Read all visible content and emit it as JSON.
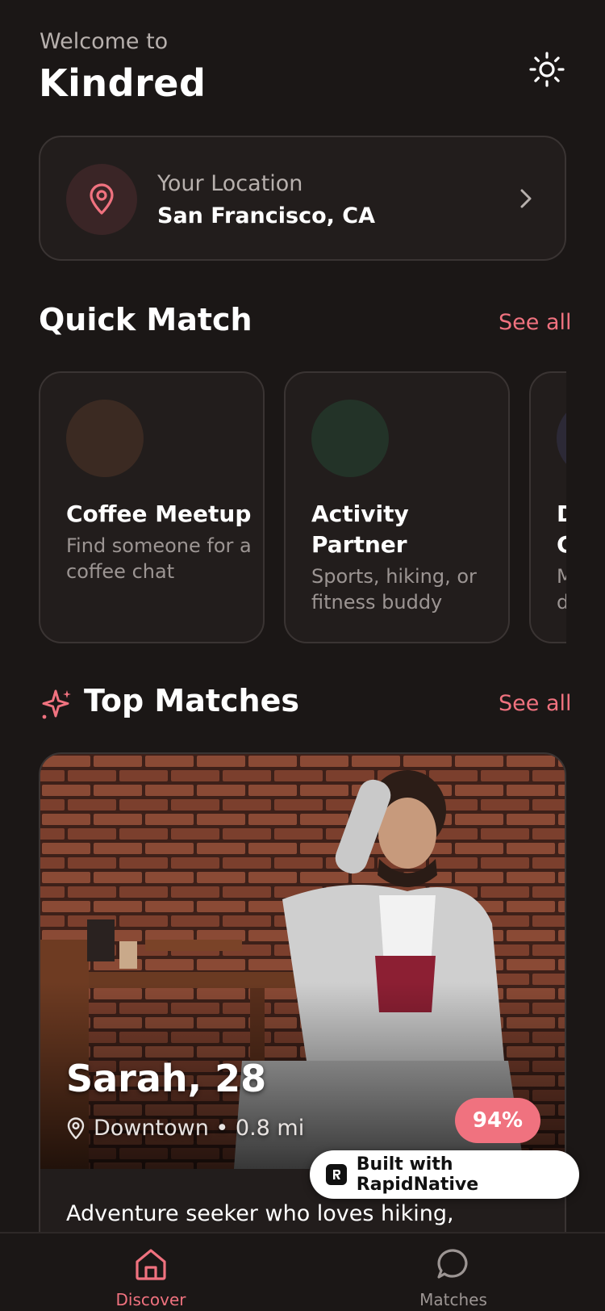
{
  "header": {
    "welcome": "Welcome to",
    "app_name": "Kindred",
    "theme_toggle_icon": "sun-icon"
  },
  "location": {
    "label": "Your Location",
    "value": "San Francisco, CA",
    "icon": "map-pin-icon"
  },
  "quick_match": {
    "title": "Quick Match",
    "see_all": "See all",
    "cards": [
      {
        "title": "Coffee Meetup",
        "desc": "Find someone for a coffee chat",
        "color": "#3b2a22"
      },
      {
        "title": "Activity Partner",
        "desc": "Sports, hiking, or fitness buddy",
        "color": "#233328"
      },
      {
        "title": "D C",
        "desc": "M d",
        "color": "#2c2936"
      }
    ]
  },
  "top_matches": {
    "title": "Top Matches",
    "see_all": "See all",
    "icon": "sparkle-icon",
    "card": {
      "name": "Sarah, 28",
      "location": "Downtown • 0.8 mi",
      "match_percent": "94%",
      "bio": "Adventure seeker who loves hiking,"
    }
  },
  "badge": {
    "label": "Built with RapidNative"
  },
  "nav": {
    "items": [
      {
        "label": "Discover",
        "icon": "home-icon",
        "active": true
      },
      {
        "label": "Matches",
        "icon": "chat-bubble-icon",
        "active": false
      }
    ]
  },
  "colors": {
    "accent": "#f0727f",
    "background": "#1b1716",
    "card": "#221d1c",
    "border": "#3a3433",
    "muted_text": "#b7b0ad"
  }
}
